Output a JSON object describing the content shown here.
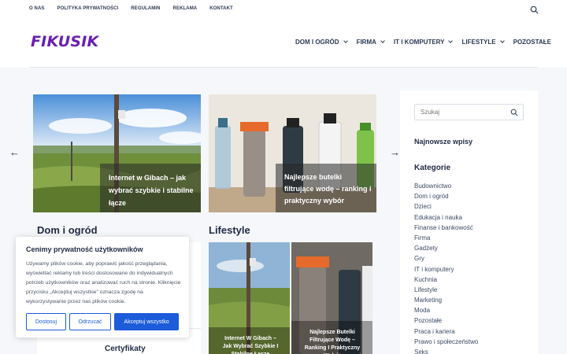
{
  "top_nav": {
    "items": [
      "O NAS",
      "POLITYKA PRYWATNOŚCI",
      "REGULAMIN",
      "REKLAMA",
      "KONTAKT"
    ]
  },
  "header": {
    "logo": "FIKUSIK",
    "nav": [
      {
        "label": "DOM I OGRÓD",
        "has_dropdown": true
      },
      {
        "label": "FIRMA",
        "has_dropdown": true
      },
      {
        "label": "IT I KOMPUTERY",
        "has_dropdown": true
      },
      {
        "label": "LIFESTYLE",
        "has_dropdown": true
      },
      {
        "label": "POZOSTAŁE",
        "has_dropdown": false
      }
    ]
  },
  "slider": {
    "slides": [
      {
        "title": "Internet w Gibach – jak wybrać szybkie i stabilne łącze"
      },
      {
        "title": "Najlepsze butelki filtrujące wodę – ranking i praktyczny wybór"
      }
    ]
  },
  "sections": {
    "left_title": "Dom i ogród",
    "right_title": "Lifestyle",
    "lifestyle_cards": [
      {
        "title": "Internet W Gibach – Jak Wybrać Szybkie I Stabilne Łącze"
      },
      {
        "title": "Najlepsze Butelki Filtrujące Wodę – Ranking I Praktyczny Wybór"
      }
    ],
    "cert_title": "Certyfikaty"
  },
  "sidebar": {
    "search_placeholder": "Szukaj",
    "recent_title": "Najnowsze wpisy",
    "categories_title": "Kategorie",
    "categories": [
      "Budownictwo",
      "Dom i ogród",
      "Dzieci",
      "Edukacja i nauka",
      "Finanse i bankowość",
      "Firma",
      "Gadżety",
      "Gry",
      "IT i komputery",
      "Kuchnia",
      "Lifestyle",
      "Marketing",
      "Moda",
      "Pozostałe",
      "Praca i kariera",
      "Prawo i społeczeństwo",
      "Seks"
    ]
  },
  "cookie": {
    "title": "Cenimy prywatność użytkowników",
    "text": "Używamy plików cookie, aby poprawić jakość przeglądania, wyświetlać reklamy lub treści dostosowane do indywidualnych potrzeb użytkowników oraz analizować ruch na stronie. Kliknięcie przycisku „Akceptuj wszystkie” oznacza zgodę na wykorzystywanie przez nas plików cookie.",
    "customize_label": "Dostosuj",
    "reject_label": "Odrzucać",
    "accept_label": "Akceptuj wszystko"
  },
  "colors": {
    "brand": "#6a1fb0",
    "accent": "#1c5bd9",
    "page_bg": "#f5f7fa"
  }
}
